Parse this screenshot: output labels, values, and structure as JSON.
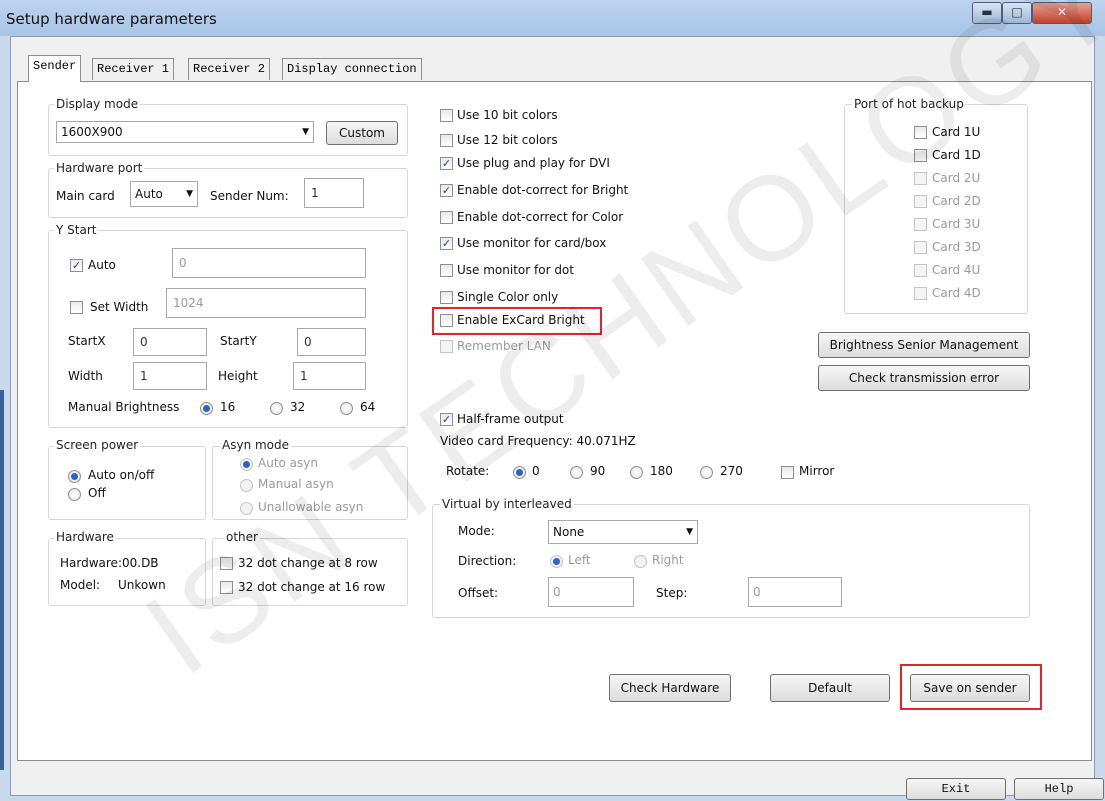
{
  "window": {
    "title": "Setup hardware parameters",
    "min_icon": "minimize-icon",
    "max_icon": "maximize-icon",
    "close_icon": "close-icon"
  },
  "tabs": [
    {
      "label": "Sender",
      "active": true
    },
    {
      "label": "Receiver 1",
      "active": false
    },
    {
      "label": "Receiver 2",
      "active": false
    },
    {
      "label": "Display connection",
      "active": false
    }
  ],
  "display_mode": {
    "title": "Display mode",
    "selected": "1600X900",
    "custom_label": "Custom"
  },
  "hardware_port": {
    "title": "Hardware port",
    "main_card_label": "Main card",
    "main_card_value": "Auto",
    "sender_num_label": "Sender Num:",
    "sender_num_value": "1"
  },
  "y_start": {
    "title": "Y Start",
    "auto_label": "Auto",
    "auto_checked": true,
    "auto_value": "0",
    "set_width_label": "Set Width",
    "set_width_checked": false,
    "set_width_value": "1024",
    "startx_label": "StartX",
    "startx_value": "0",
    "starty_label": "StartY",
    "starty_value": "0",
    "width_label": "Width",
    "width_value": "1",
    "height_label": "Height",
    "height_value": "1",
    "manual_brightness_label": "Manual Brightness",
    "brightness_options": [
      "16",
      "32",
      "64"
    ],
    "brightness_selected": "16"
  },
  "screen_power": {
    "title": "Screen power",
    "options": [
      "Auto on/off",
      "Off"
    ],
    "selected": "Auto on/off"
  },
  "asyn_mode": {
    "title": "Asyn mode",
    "options": [
      "Auto asyn",
      "Manual asyn",
      "Unallowable asyn"
    ],
    "selected": "Auto asyn"
  },
  "hardware": {
    "title": "Hardware",
    "hardware_line": "Hardware:00.DB",
    "model_label": "Model:",
    "model_value": "Unkown"
  },
  "other": {
    "title": "other",
    "options": [
      {
        "label": "32 dot change at 8 row",
        "checked": false
      },
      {
        "label": "32 dot change at 16 row",
        "checked": false
      }
    ]
  },
  "options": [
    {
      "label": "Use 10 bit colors",
      "checked": false,
      "disabled": false
    },
    {
      "label": "Use 12 bit colors",
      "checked": false,
      "disabled": false
    },
    {
      "label": "Use plug and play for DVI",
      "checked": true,
      "disabled": false
    },
    {
      "label": "Enable dot-correct for Bright",
      "checked": true,
      "disabled": false
    },
    {
      "label": "Enable dot-correct for Color",
      "checked": false,
      "disabled": false
    },
    {
      "label": "Use monitor for card/box",
      "checked": true,
      "disabled": false
    },
    {
      "label": "Use monitor for dot",
      "checked": false,
      "disabled": false
    },
    {
      "label": "Single Color only",
      "checked": false,
      "disabled": false
    },
    {
      "label": "Enable ExCard Bright",
      "checked": false,
      "disabled": false
    },
    {
      "label": "Remember LAN",
      "checked": false,
      "disabled": true
    }
  ],
  "half_frame": {
    "label": "Half-frame output",
    "checked": true
  },
  "video_freq": "Video card Frequency: 40.071HZ",
  "rotate": {
    "label": "Rotate:",
    "options": [
      "0",
      "90",
      "180",
      "270"
    ],
    "selected": "0",
    "mirror_label": "Mirror"
  },
  "virtual": {
    "title": "Virtual by interleaved",
    "mode_label": "Mode:",
    "mode_value": "None",
    "direction_label": "Direction:",
    "direction_options": [
      "Left",
      "Right"
    ],
    "offset_label": "Offset:",
    "offset_value": "0",
    "step_label": "Step:",
    "step_value": "0"
  },
  "hot_backup": {
    "title": "Port of hot backup",
    "cards": [
      {
        "label": "Card 1U",
        "disabled": false
      },
      {
        "label": "Card 1D",
        "disabled": false
      },
      {
        "label": "Card 2U",
        "disabled": true
      },
      {
        "label": "Card 2D",
        "disabled": true
      },
      {
        "label": "Card 3U",
        "disabled": true
      },
      {
        "label": "Card 3D",
        "disabled": true
      },
      {
        "label": "Card 4U",
        "disabled": true
      },
      {
        "label": "Card 4D",
        "disabled": true
      }
    ]
  },
  "buttons": {
    "brightness_mgmt": "Brightness Senior Management",
    "check_transmission": "Check transmission error",
    "check_hardware": "Check Hardware",
    "default": "Default",
    "save_on_sender": "Save on sender",
    "exit": "Exit",
    "help": "Help"
  },
  "watermark": "ISN TECHNOLOGY",
  "highlight_color": "#e0262c"
}
